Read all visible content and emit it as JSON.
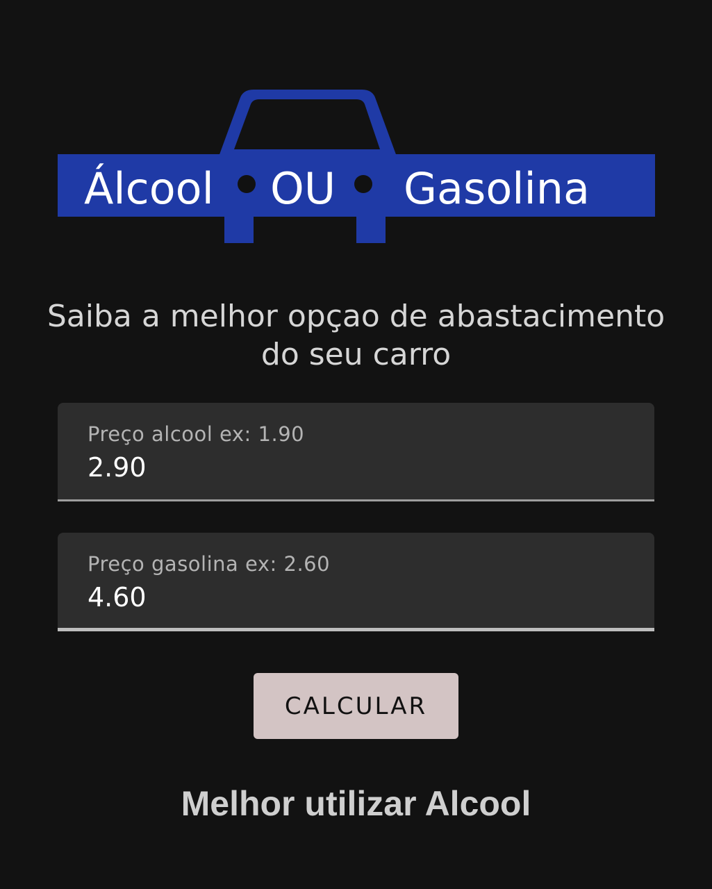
{
  "logo": {
    "word_left": "Álcool",
    "word_mid": "OU",
    "word_right": "Gasolina",
    "color": "#1f3aa6"
  },
  "subtitle": {
    "line1": "Saiba a melhor opçao de abastacimento",
    "line2": "do seu carro"
  },
  "alcool_field": {
    "label": "Preço alcool ex: 1.90",
    "value": "2.90"
  },
  "gasolina_field": {
    "label": "Preço gasolina ex: 2.60",
    "value": "4.60"
  },
  "calc_button": {
    "label": "CALCULAR"
  },
  "result": {
    "text": "Melhor utilizar Alcool"
  }
}
